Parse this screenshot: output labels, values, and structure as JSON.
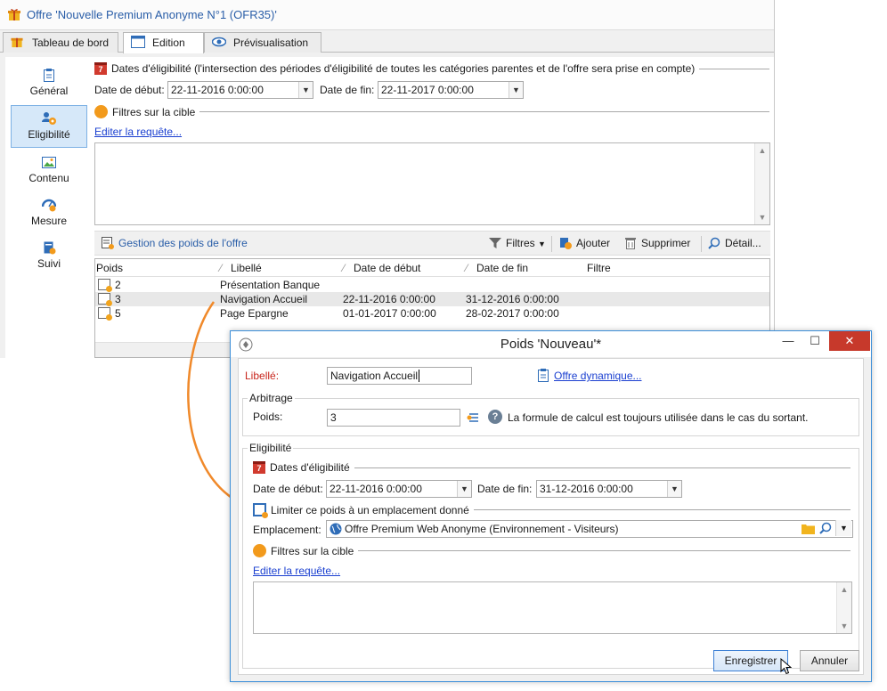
{
  "window": {
    "title": "Offre 'Nouvelle Premium Anonyme N°1 (OFR35)'",
    "tabs": [
      {
        "label": "Tableau de bord",
        "icon": "gift-icon"
      },
      {
        "label": "Edition",
        "icon": "window-icon",
        "active": true
      },
      {
        "label": "Prévisualisation",
        "icon": "eye-icon"
      }
    ]
  },
  "sidebar": {
    "items": [
      {
        "label": "Général",
        "icon": "clipboard-icon"
      },
      {
        "label": "Eligibilité",
        "icon": "users-target-icon",
        "active": true
      },
      {
        "label": "Contenu",
        "icon": "image-icon"
      },
      {
        "label": "Mesure",
        "icon": "gauge-icon"
      },
      {
        "label": "Suivi",
        "icon": "tracking-icon"
      }
    ]
  },
  "eligibility": {
    "dates_header": "Dates d'éligibilité (l'intersection des périodes d'éligibilité de toutes les catégories parentes et de l'offre sera prise en compte)",
    "start_label": "Date de début:",
    "start_value": "22-11-2016 0:00:00",
    "end_label": "Date de fin:",
    "end_value": "22-11-2017 0:00:00",
    "filters_header": "Filtres sur la cible",
    "edit_query_link": "Editer la requête..."
  },
  "weights": {
    "title": "Gestion des poids de l'offre",
    "toolbar": {
      "filters": "Filtres",
      "add": "Ajouter",
      "delete": "Supprimer",
      "detail": "Détail..."
    },
    "columns": [
      "Poids",
      "Libellé",
      "Date de début",
      "Date de fin",
      "Filtre"
    ],
    "rows": [
      {
        "poids": "2",
        "libelle": "Présentation Banque",
        "debut": "",
        "fin": "",
        "filtre": ""
      },
      {
        "poids": "3",
        "libelle": "Navigation Accueil",
        "debut": "22-11-2016 0:00:00",
        "fin": "31-12-2016 0:00:00",
        "filtre": "",
        "selected": true
      },
      {
        "poids": "5",
        "libelle": "Page Epargne",
        "debut": "01-01-2017 0:00:00",
        "fin": "28-02-2017 0:00:00",
        "filtre": ""
      }
    ]
  },
  "dialog": {
    "title": "Poids 'Nouveau'*",
    "libelle_label": "Libellé:",
    "libelle_value": "Navigation Accueil",
    "dynamic_offer_link": "Offre dynamique...",
    "arbitrage_label": "Arbitrage",
    "poids_label": "Poids:",
    "poids_value": "3",
    "formula_note": "La formule de calcul est toujours utilisée dans le cas du sortant.",
    "eligibility_label": "Eligibilité",
    "dates_header": "Dates d'éligibilité",
    "start_label": "Date de début:",
    "start_value": "22-11-2016 0:00:00",
    "end_label": "Date de fin:",
    "end_value": "31-12-2016 0:00:00",
    "limit_label": "Limiter ce poids à un emplacement donné",
    "location_label": "Emplacement:",
    "location_value": "Offre Premium Web Anonyme  (Environnement - Visiteurs)",
    "filters_header": "Filtres sur la cible",
    "edit_query_link": "Editer la requête...",
    "save_button": "Enregistrer",
    "cancel_button": "Annuler"
  },
  "colors": {
    "accent": "#3c8fd9",
    "title_text": "#2a5ea8",
    "arrow": "#f0892a",
    "close": "#c7392b",
    "mandatory_label": "#c8251c"
  }
}
